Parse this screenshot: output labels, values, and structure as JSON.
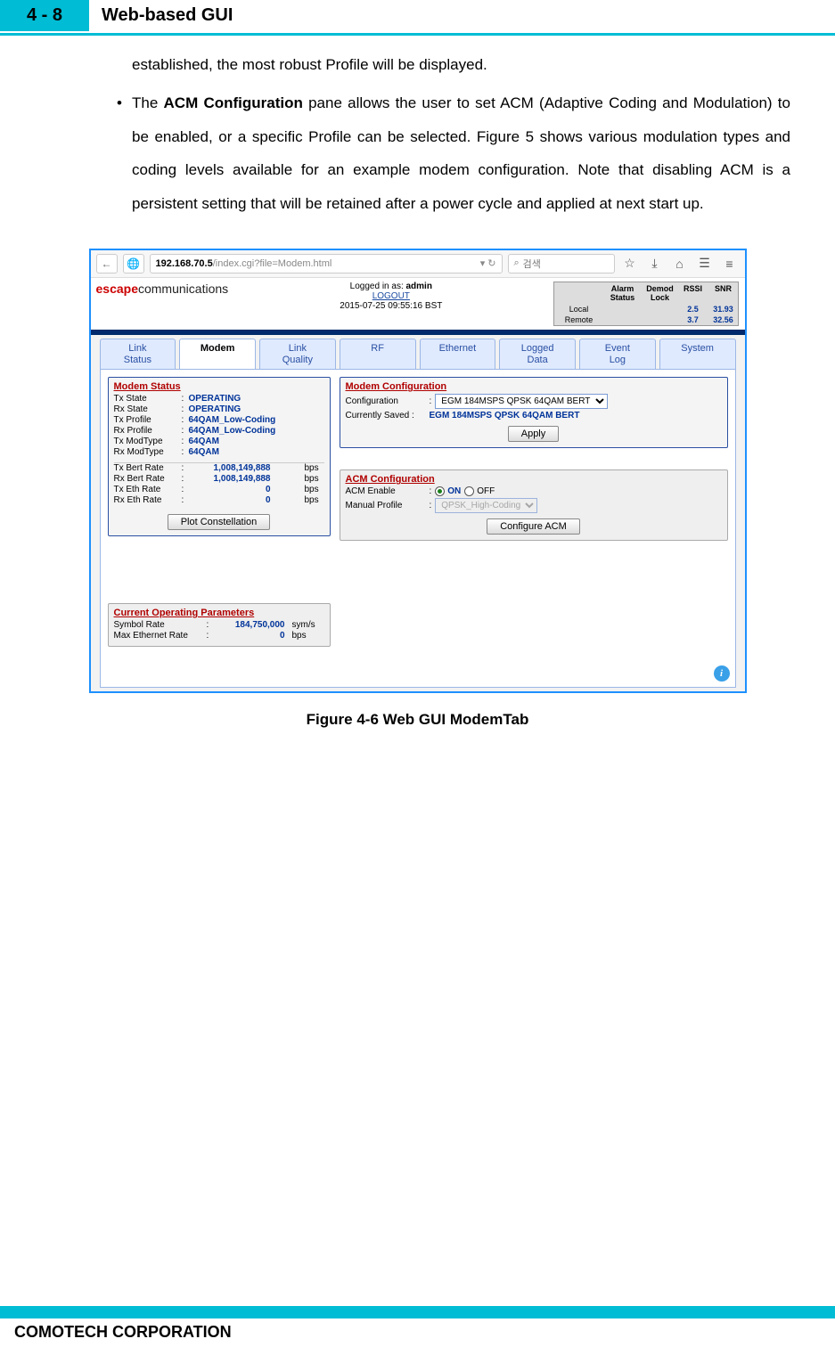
{
  "header": {
    "page_tab": "4 - 8",
    "title": "Web-based GUI"
  },
  "body": {
    "line1": "established, the most robust Profile will be displayed.",
    "bullet_prefix": "The ",
    "bullet_bold": "ACM Configuration",
    "bullet_rest": " pane allows the user to set ACM (Adaptive Coding and Modulation) to be enabled, or a specific Profile can be selected. Figure 5 shows various modulation types and coding levels available for an example modem configuration. Note that disabling ACM is a persistent setting that will be retained after a power cycle and applied at next start up."
  },
  "browser": {
    "back_glyph": "←",
    "url_prefix": "192.168.70.5",
    "url_suffix": "/index.cgi?file=Modem.html",
    "search_icon": "⌕",
    "search_placeholder": "검색",
    "icons": {
      "star": "☆",
      "download": "⤓",
      "home": "⌂",
      "book": "☰",
      "menu": "≡"
    }
  },
  "brand": {
    "logo_red": "escape",
    "logo_black": "communications",
    "login_line": "Logged in as: ",
    "login_user": "admin",
    "logout": "LOGOUT",
    "timestamp": "2015-07-25 09:55:16 BST"
  },
  "status": {
    "cols": [
      "",
      "Alarm Status",
      "Demod Lock",
      "RSSI",
      "SNR"
    ],
    "rows": [
      {
        "lbl": "Local",
        "rssi": "2.5",
        "snr": "31.93"
      },
      {
        "lbl": "Remote",
        "rssi": "3.7",
        "snr": "32.56"
      }
    ]
  },
  "tabs": [
    "Link Status",
    "Modem",
    "Link Quality",
    "RF",
    "Ethernet",
    "Logged Data",
    "Event Log",
    "System"
  ],
  "tabs_two": [
    "Link\nStatus",
    "Modem",
    "Link\nQuality",
    "RF",
    "Ethernet",
    "Logged\nData",
    "Event\nLog",
    "System"
  ],
  "modem_status": {
    "title": "Modem Status",
    "rows": [
      [
        "Tx State",
        "OPERATING"
      ],
      [
        "Rx State",
        "OPERATING"
      ],
      [
        "Tx Profile",
        "64QAM_Low-Coding"
      ],
      [
        "Rx Profile",
        "64QAM_Low-Coding"
      ],
      [
        "Tx ModType",
        "64QAM"
      ],
      [
        "Rx ModType",
        "64QAM"
      ]
    ],
    "rates": [
      [
        "Tx Bert Rate",
        "1,008,149,888",
        "bps"
      ],
      [
        "Rx Bert Rate",
        "1,008,149,888",
        "bps"
      ],
      [
        "Tx Eth Rate",
        "0",
        "bps"
      ],
      [
        "Rx Eth Rate",
        "0",
        "bps"
      ]
    ],
    "btn": "Plot Constellation"
  },
  "op_params": {
    "title": "Current Operating Parameters",
    "rows": [
      [
        "Symbol Rate",
        "184,750,000",
        "sym/s"
      ],
      [
        "Max Ethernet Rate",
        "0",
        "bps"
      ]
    ]
  },
  "modem_cfg": {
    "title": "Modem Configuration",
    "cfg_lbl": "Configuration",
    "cfg_val": "EGM 184MSPS QPSK 64QAM BERT",
    "saved_lbl": "Currently Saved :",
    "saved_val": "EGM 184MSPS QPSK 64QAM BERT",
    "apply": "Apply"
  },
  "acm_cfg": {
    "title": "ACM Configuration",
    "enable_lbl": "ACM Enable",
    "on": "ON",
    "off": "OFF",
    "profile_lbl": "Manual Profile",
    "profile_val": "QPSK_High-Coding",
    "btn": "Configure ACM"
  },
  "figcap": "Figure 4-6 Web GUI ModemTab",
  "footer": "COMOTECH CORPORATION"
}
